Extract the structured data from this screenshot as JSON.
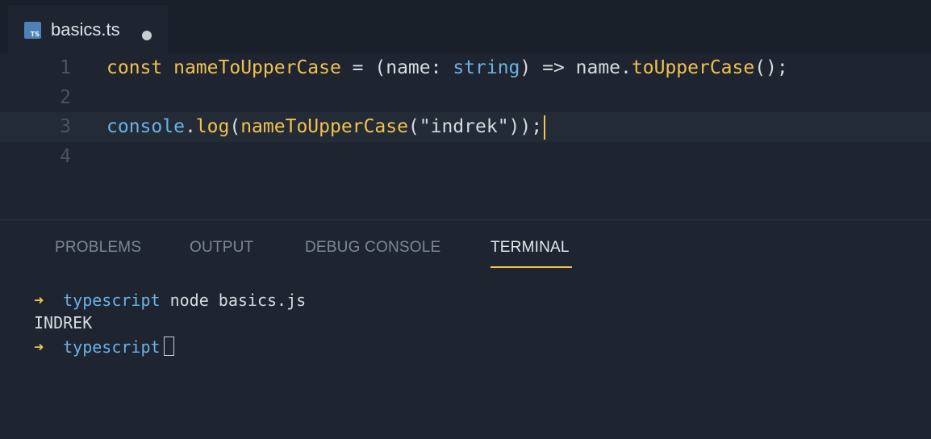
{
  "tab": {
    "filename": "basics.ts",
    "icon_text": "TS",
    "icon": "typescript-file-icon",
    "dirty": true
  },
  "editor": {
    "lines": [
      {
        "number": "1",
        "tokens": [
          "const",
          " ",
          "nameToUpperCase",
          " = (name: ",
          "string",
          ") => name.",
          "toUpperCase",
          "();"
        ]
      },
      {
        "number": "2",
        "tokens": []
      },
      {
        "number": "3",
        "tokens": [
          "console",
          ".",
          "log",
          "(",
          "nameToUpperCase",
          "(\"indrek\"));"
        ]
      },
      {
        "number": "4",
        "tokens": []
      }
    ]
  },
  "panel": {
    "tabs": [
      {
        "label": "PROBLEMS"
      },
      {
        "label": "OUTPUT"
      },
      {
        "label": "DEBUG CONSOLE"
      },
      {
        "label": "TERMINAL"
      }
    ],
    "active_tab": "TERMINAL"
  },
  "terminal": {
    "line1": {
      "arrow": "➜",
      "dir": "typescript",
      "command": " node basics.js"
    },
    "output": "INDREK",
    "line3": {
      "arrow": "➜",
      "dir": "typescript"
    }
  },
  "colors": {
    "accent": "#f2c14e",
    "type": "#6cb2e6",
    "background": "#1e2530"
  }
}
